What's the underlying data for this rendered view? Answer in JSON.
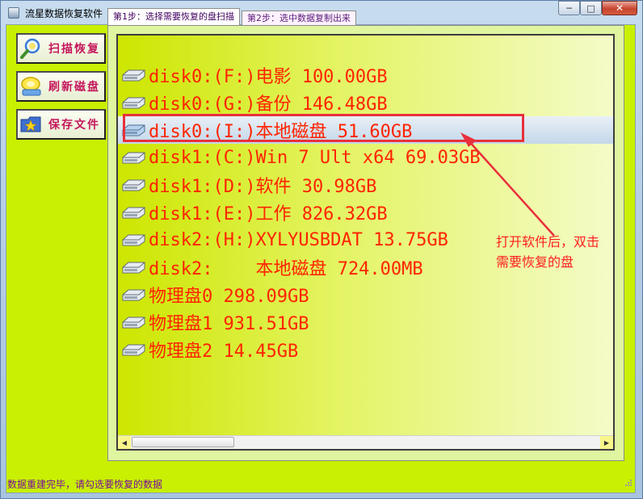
{
  "window": {
    "title": "流星数据恢复软件  -ADR科技",
    "controls": {
      "minimize": "─",
      "maximize": "□",
      "close": "✕"
    }
  },
  "sidebar": {
    "items": [
      {
        "label": "扫描恢复",
        "icon": "magnifier-icon"
      },
      {
        "label": "刷新磁盘",
        "icon": "disk-refresh-icon"
      },
      {
        "label": "保存文件",
        "icon": "folder-star-icon"
      }
    ]
  },
  "tabs": [
    {
      "label": "第1步：选择需要恢复的盘扫描",
      "active": true
    },
    {
      "label": "第2步：选中数据复制出来",
      "active": false
    }
  ],
  "disk_list": {
    "items": [
      {
        "label": "disk0:(F:)电影 100.00GB",
        "selected": false
      },
      {
        "label": "disk0:(G:)备份 146.48GB",
        "selected": false
      },
      {
        "label": "disk0:(I:)本地磁盘 51.60GB",
        "selected": true
      },
      {
        "label": "disk1:(C:)Win 7 Ult x64 69.03GB",
        "selected": false
      },
      {
        "label": "disk1:(D:)软件 30.98GB",
        "selected": false
      },
      {
        "label": "disk1:(E:)工作 826.32GB",
        "selected": false
      },
      {
        "label": "disk2:(H:)XYLYUSBDAT 13.75GB",
        "selected": false
      },
      {
        "label": "disk2:    本地磁盘 724.00MB",
        "selected": false
      },
      {
        "label": "物理盘0 298.09GB",
        "selected": false
      },
      {
        "label": "物理盘1 931.51GB",
        "selected": false
      },
      {
        "label": "物理盘2 14.45GB",
        "selected": false
      }
    ]
  },
  "annotation": {
    "line1": "打开软件后，双击",
    "line2": "需要恢复的盘"
  },
  "status": {
    "text": "数据重建完毕，请勾选要恢复的数据"
  },
  "colors": {
    "client_bg": "#c8f000",
    "item_text": "#ff2300",
    "sidebar_text": "#c4185c",
    "annotation": "#ff1e1e",
    "status_text": "#7a0aa0"
  }
}
